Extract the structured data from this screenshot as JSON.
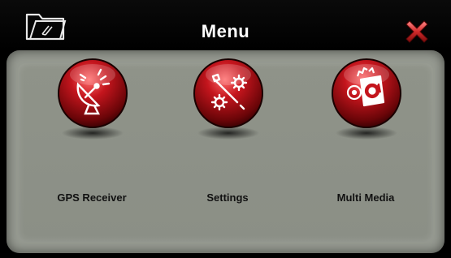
{
  "header": {
    "title": "Menu",
    "back_icon": "folder-back-icon",
    "close_icon": "close-x-icon"
  },
  "colors": {
    "header_bg": "#000000",
    "panel_bg": "#969a91",
    "orb_red": "#a50f16",
    "close_red": "#d22a2a",
    "title_text": "#ffffff",
    "label_text": "#111111"
  },
  "menu": {
    "items": [
      {
        "label": "GPS Receiver",
        "icon": "satellite-dish-icon"
      },
      {
        "label": "Settings",
        "icon": "wrench-gears-icon"
      },
      {
        "label": "Multi Media",
        "icon": "media-folder-icon"
      }
    ]
  }
}
